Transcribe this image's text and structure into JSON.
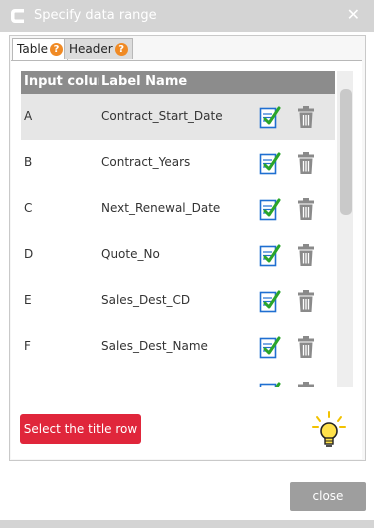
{
  "window": {
    "title": "Specify data range",
    "close_glyph": "✕"
  },
  "tabs": [
    {
      "label": "Table",
      "help_glyph": "?"
    },
    {
      "label": "Header",
      "help_glyph": "?"
    }
  ],
  "grid": {
    "headers": [
      "Input colum",
      "Label Name"
    ],
    "rows": [
      {
        "col": "A",
        "label": "Contract_Start_Date"
      },
      {
        "col": "B",
        "label": "Contract_Years"
      },
      {
        "col": "C",
        "label": "Next_Renewal_Date"
      },
      {
        "col": "D",
        "label": "Quote_No"
      },
      {
        "col": "E",
        "label": "Sales_Dest_CD"
      },
      {
        "col": "F",
        "label": "Sales_Dest_Name"
      },
      {
        "col": "",
        "label": ""
      }
    ],
    "selected_row": 0,
    "row_icons": [
      "edit-icon",
      "trash-icon"
    ]
  },
  "buttons": {
    "select_title_row": "Select the title row",
    "close": "close"
  },
  "hint_icon": "lightbulb-icon",
  "colors": {
    "titlebar": "#d4d4d4",
    "grid_header": "#8c8c8c",
    "primary_button": "#e0263b",
    "close_button": "#9e9e9e",
    "help_badge": "#f08a24",
    "edit_check": "#2aa52a",
    "edit_doc": "#1f6fd1"
  }
}
